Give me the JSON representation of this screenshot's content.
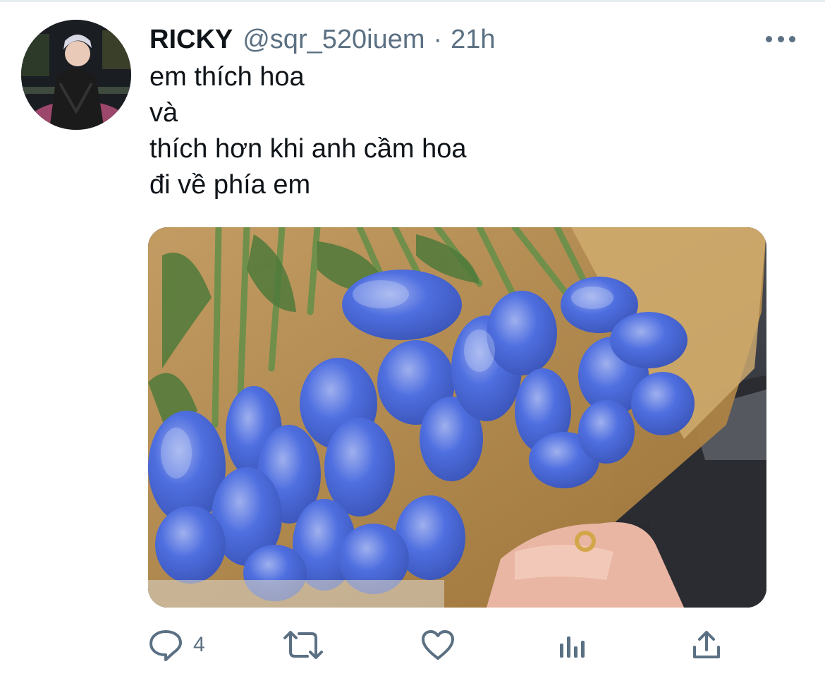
{
  "tweet": {
    "author_name": "RICKY",
    "handle": "@sqr_520iuem",
    "separator": "·",
    "time": "21h",
    "text_lines": [
      "em thích hoa",
      "và",
      "thích hơn khi anh cầm hoa",
      "đi về phía em"
    ]
  },
  "actions": {
    "reply_icon": "reply-icon",
    "reply_count": "4",
    "retweet_icon": "retweet-icon",
    "like_icon": "heart-icon",
    "analytics_icon": "analytics-icon",
    "share_icon": "share-icon"
  },
  "colors": {
    "text_primary": "#0f1419",
    "text_secondary": "#5b7083",
    "divider": "#e6ecf0"
  }
}
